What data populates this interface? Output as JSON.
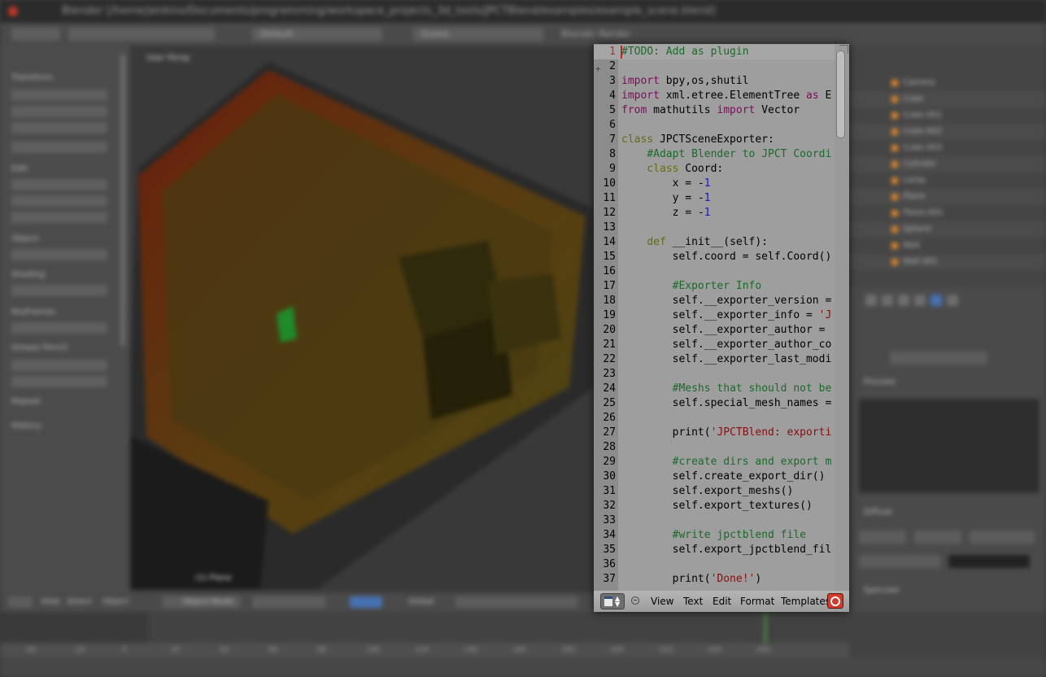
{
  "background": {
    "window_title": "Blender [/home/jenkins/Documents/programming/workspace_projects_3d_tools/JPCTBlend/examples/example_scene.blend]",
    "info_bar": {
      "layout": "Default",
      "scene": "Scene",
      "engine": "Blender Render"
    },
    "viewport": {
      "label": "User Persp",
      "corner_text": "(1) Plane"
    },
    "tool_shelf_headers": [
      "Transform:",
      "Edit:",
      "Object:",
      "Shading:",
      "Keyframes:",
      "Grease Pencil:",
      "Repeat:",
      "History:"
    ],
    "viewport_header": {
      "view": "View",
      "select": "Select",
      "object": "Object",
      "mode": "Object Mode",
      "pivot": "Global"
    },
    "timeline_ticks": [
      "-40",
      "-20",
      "0",
      "20",
      "40",
      "60",
      "80",
      "100",
      "120",
      "140",
      "160",
      "180",
      "200",
      "220",
      "240",
      "260"
    ],
    "outliner_items": [
      "Camera",
      "Cube",
      "Cube.001",
      "Cube.002",
      "Cube.003",
      "Cylinder",
      "Lamp",
      "Plane",
      "Plane.001",
      "Sphere",
      "Wall",
      "Wall.001"
    ],
    "properties": {
      "section_1": "Preview",
      "section_2": "Diffuse",
      "section_3": "Specular"
    }
  },
  "editor": {
    "current_line": 1,
    "lines": [
      {
        "n": "1",
        "t": [
          {
            "c": "cm",
            "s": "#TODO: Add as plugin"
          }
        ]
      },
      {
        "n": "2",
        "t": []
      },
      {
        "n": "3",
        "t": [
          {
            "c": "kw",
            "s": "import"
          },
          {
            "c": "",
            "s": " bpy,os,shutil"
          }
        ]
      },
      {
        "n": "4",
        "t": [
          {
            "c": "kw",
            "s": "import"
          },
          {
            "c": "",
            "s": " xml.etree.ElementTree "
          },
          {
            "c": "kw",
            "s": "as"
          },
          {
            "c": "",
            "s": " E"
          }
        ]
      },
      {
        "n": "5",
        "t": [
          {
            "c": "kw",
            "s": "from"
          },
          {
            "c": "",
            "s": " mathutils "
          },
          {
            "c": "kw",
            "s": "import"
          },
          {
            "c": "",
            "s": " Vector"
          }
        ]
      },
      {
        "n": "6",
        "t": []
      },
      {
        "n": "7",
        "t": [
          {
            "c": "sf",
            "s": "class"
          },
          {
            "c": "",
            "s": " JPCTSceneExporter:"
          }
        ]
      },
      {
        "n": "8",
        "t": [
          {
            "c": "",
            "s": "    "
          },
          {
            "c": "cm",
            "s": "#Adapt Blender to JPCT Coordi"
          }
        ]
      },
      {
        "n": "9",
        "t": [
          {
            "c": "",
            "s": "    "
          },
          {
            "c": "sf",
            "s": "class"
          },
          {
            "c": "",
            "s": " Coord:"
          }
        ]
      },
      {
        "n": "10",
        "t": [
          {
            "c": "",
            "s": "        x = -"
          },
          {
            "c": "nm",
            "s": "1"
          }
        ]
      },
      {
        "n": "11",
        "t": [
          {
            "c": "",
            "s": "        y = -"
          },
          {
            "c": "nm",
            "s": "1"
          }
        ]
      },
      {
        "n": "12",
        "t": [
          {
            "c": "",
            "s": "        z = -"
          },
          {
            "c": "nm",
            "s": "1"
          }
        ]
      },
      {
        "n": "13",
        "t": []
      },
      {
        "n": "14",
        "t": [
          {
            "c": "",
            "s": "    "
          },
          {
            "c": "sf",
            "s": "def"
          },
          {
            "c": "",
            "s": " __init__(self):"
          }
        ]
      },
      {
        "n": "15",
        "t": [
          {
            "c": "",
            "s": "        self.coord = self.Coord()"
          }
        ]
      },
      {
        "n": "16",
        "t": []
      },
      {
        "n": "17",
        "t": [
          {
            "c": "",
            "s": "        "
          },
          {
            "c": "cm",
            "s": "#Exporter Info"
          }
        ]
      },
      {
        "n": "18",
        "t": [
          {
            "c": "",
            "s": "        self.__exporter_version ="
          }
        ]
      },
      {
        "n": "19",
        "t": [
          {
            "c": "",
            "s": "        self.__exporter_info = "
          },
          {
            "c": "st",
            "s": "'J"
          }
        ]
      },
      {
        "n": "20",
        "t": [
          {
            "c": "",
            "s": "        self.__exporter_author ="
          }
        ]
      },
      {
        "n": "21",
        "t": [
          {
            "c": "",
            "s": "        self.__exporter_author_co"
          }
        ]
      },
      {
        "n": "22",
        "t": [
          {
            "c": "",
            "s": "        self.__exporter_last_modi"
          }
        ]
      },
      {
        "n": "23",
        "t": []
      },
      {
        "n": "24",
        "t": [
          {
            "c": "",
            "s": "        "
          },
          {
            "c": "cm",
            "s": "#Meshs that should not be"
          }
        ]
      },
      {
        "n": "25",
        "t": [
          {
            "c": "",
            "s": "        self.special_mesh_names ="
          }
        ]
      },
      {
        "n": "26",
        "t": []
      },
      {
        "n": "27",
        "t": [
          {
            "c": "",
            "s": "        print("
          },
          {
            "c": "st",
            "s": "'JPCTBlend: exporti"
          }
        ]
      },
      {
        "n": "28",
        "t": []
      },
      {
        "n": "29",
        "t": [
          {
            "c": "",
            "s": "        "
          },
          {
            "c": "cm",
            "s": "#create dirs and export m"
          }
        ]
      },
      {
        "n": "30",
        "t": [
          {
            "c": "",
            "s": "        self.create_export_dir()"
          }
        ]
      },
      {
        "n": "31",
        "t": [
          {
            "c": "",
            "s": "        self.export_meshs()"
          }
        ]
      },
      {
        "n": "32",
        "t": [
          {
            "c": "",
            "s": "        self.export_textures()"
          }
        ]
      },
      {
        "n": "33",
        "t": []
      },
      {
        "n": "34",
        "t": [
          {
            "c": "",
            "s": "        "
          },
          {
            "c": "cm",
            "s": "#write jpctblend file"
          }
        ]
      },
      {
        "n": "35",
        "t": [
          {
            "c": "",
            "s": "        self.export_jpctblend_fil"
          }
        ]
      },
      {
        "n": "36",
        "t": []
      },
      {
        "n": "37",
        "t": [
          {
            "c": "",
            "s": "        print("
          },
          {
            "c": "st",
            "s": "'Done!'"
          },
          {
            "c": "",
            "s": ")"
          }
        ]
      }
    ],
    "menu": {
      "view": "View",
      "text": "Text",
      "edit": "Edit",
      "format": "Format",
      "templates": "Templates"
    }
  }
}
